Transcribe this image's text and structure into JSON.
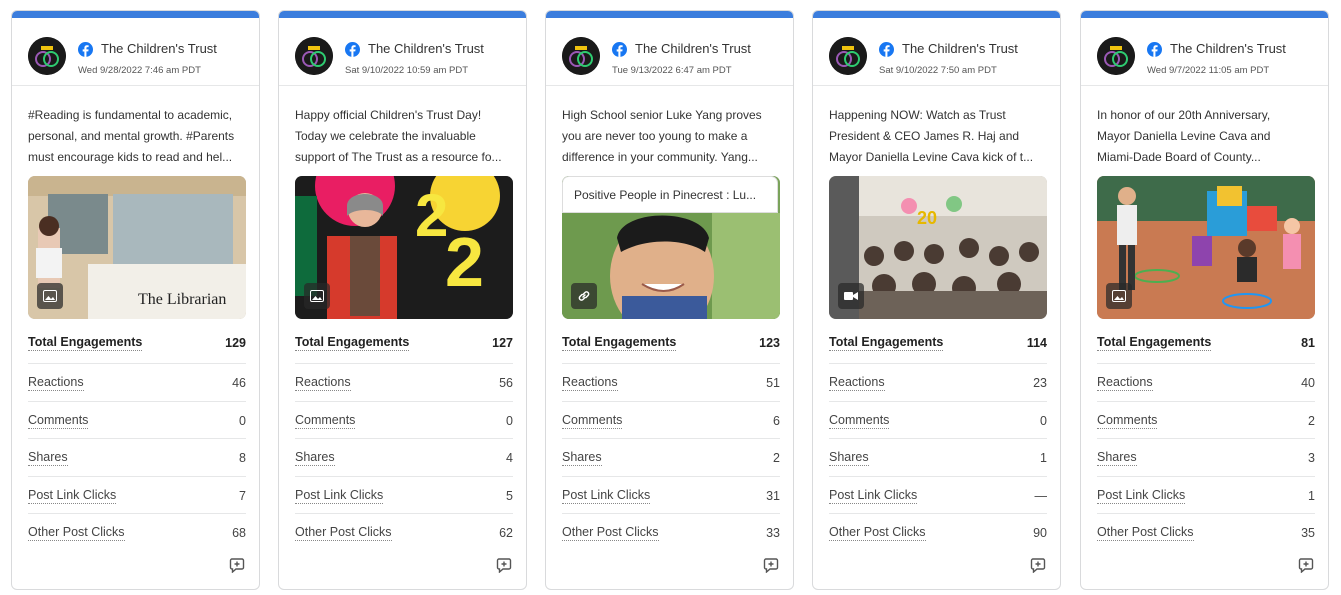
{
  "colors": {
    "accent_bar": "#3b7ddd",
    "facebook_blue": "#1877f2",
    "divider": "#e6e7e8"
  },
  "icons": {
    "network": "facebook-icon",
    "media_photo": "photo-icon",
    "media_video": "video-icon",
    "media_link": "link-icon",
    "comment": "comment-icon"
  },
  "metric_labels": {
    "total": "Total Engagements",
    "reactions": "Reactions",
    "comments": "Comments",
    "shares": "Shares",
    "post_link_clicks": "Post Link Clicks",
    "other_post_clicks": "Other Post Clicks"
  },
  "posts": [
    {
      "page_name": "The Children's Trust",
      "date": "Wed 9/28/2022 7:46 am PDT",
      "text_lines": [
        "#Reading is fundamental to academic,",
        "personal, and mental growth. #Parents",
        "must encourage kids to read and hel..."
      ],
      "media_type": "photo",
      "media_caption": "The Librarian",
      "link_title": "",
      "metrics": {
        "total": "129",
        "reactions": "46",
        "comments": "0",
        "shares": "8",
        "post_link_clicks": "7",
        "other_post_clicks": "68"
      }
    },
    {
      "page_name": "The Children's Trust",
      "date": "Sat 9/10/2022 10:59 am PDT",
      "text_lines": [
        "Happy official Children's Trust Day!",
        "Today we celebrate the invaluable",
        "support of The Trust as a resource fo..."
      ],
      "media_type": "photo",
      "media_caption": "",
      "link_title": "",
      "metrics": {
        "total": "127",
        "reactions": "56",
        "comments": "0",
        "shares": "4",
        "post_link_clicks": "5",
        "other_post_clicks": "62"
      }
    },
    {
      "page_name": "The Children's Trust",
      "date": "Tue 9/13/2022 6:47 am PDT",
      "text_lines": [
        "High School senior Luke Yang proves",
        "you are never too young to make a",
        "difference in your community. Yang..."
      ],
      "media_type": "link",
      "media_caption": "",
      "link_title": "Positive People in Pinecrest : Lu...",
      "metrics": {
        "total": "123",
        "reactions": "51",
        "comments": "6",
        "shares": "2",
        "post_link_clicks": "31",
        "other_post_clicks": "33"
      }
    },
    {
      "page_name": "The Children's Trust",
      "date": "Sat 9/10/2022 7:50 am PDT",
      "text_lines": [
        "Happening NOW: Watch as Trust",
        "President & CEO James R. Haj and",
        "Mayor Daniella Levine Cava kick of t..."
      ],
      "media_type": "video",
      "media_caption": "",
      "link_title": "",
      "metrics": {
        "total": "114",
        "reactions": "23",
        "comments": "0",
        "shares": "1",
        "post_link_clicks": "—",
        "other_post_clicks": "90"
      }
    },
    {
      "page_name": "The Children's Trust",
      "date": "Wed 9/7/2022 11:05 am PDT",
      "text_lines": [
        "In honor of our 20th Anniversary,",
        "Mayor Daniella Levine Cava and",
        "Miami-Dade Board of County..."
      ],
      "media_type": "photo",
      "media_caption": "",
      "link_title": "",
      "metrics": {
        "total": "81",
        "reactions": "40",
        "comments": "2",
        "shares": "3",
        "post_link_clicks": "1",
        "other_post_clicks": "35"
      }
    }
  ]
}
